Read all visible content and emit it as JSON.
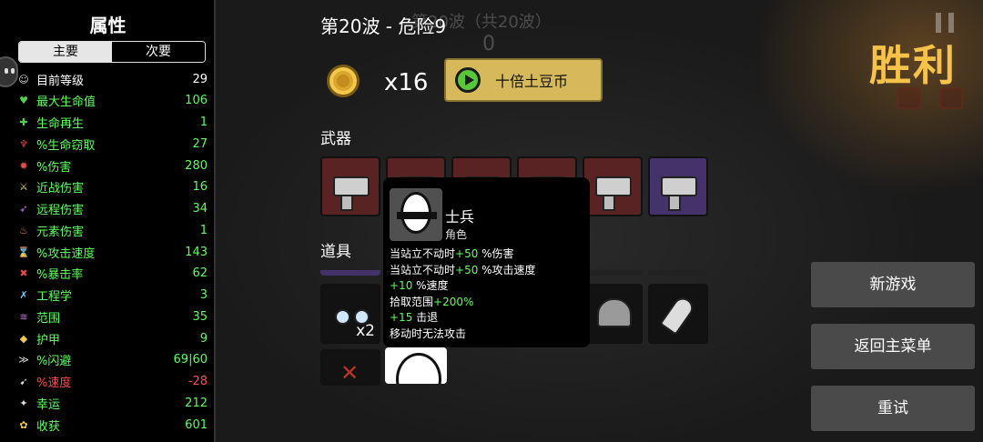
{
  "stats_panel": {
    "title": "属性",
    "tabs": {
      "primary": "主要",
      "secondary": "次要"
    },
    "rows": [
      {
        "icon": "level-icon",
        "name": "目前等级",
        "value": "29",
        "color": "white"
      },
      {
        "icon": "heart-icon",
        "name": "最大生命值",
        "value": "106",
        "color": "green"
      },
      {
        "icon": "regen-icon",
        "name": "生命再生",
        "value": "1",
        "color": "green"
      },
      {
        "icon": "lifesteal-icon",
        "name": "%生命窃取",
        "value": "27",
        "color": "green"
      },
      {
        "icon": "damage-icon",
        "name": "%伤害",
        "value": "280",
        "color": "green"
      },
      {
        "icon": "melee-icon",
        "name": "近战伤害",
        "value": "16",
        "color": "green"
      },
      {
        "icon": "ranged-icon",
        "name": "远程伤害",
        "value": "34",
        "color": "green"
      },
      {
        "icon": "elemental-icon",
        "name": "元素伤害",
        "value": "1",
        "color": "green"
      },
      {
        "icon": "attack-speed-icon",
        "name": "%攻击速度",
        "value": "143",
        "color": "green"
      },
      {
        "icon": "crit-icon",
        "name": "%暴击率",
        "value": "62",
        "color": "green"
      },
      {
        "icon": "engineering-icon",
        "name": "工程学",
        "value": "3",
        "color": "green"
      },
      {
        "icon": "range-icon",
        "name": "范围",
        "value": "35",
        "color": "green"
      },
      {
        "icon": "armor-icon",
        "name": "护甲",
        "value": "9",
        "color": "green"
      },
      {
        "icon": "dodge-icon",
        "name": "%闪避",
        "value": "69|60",
        "color": "green"
      },
      {
        "icon": "speed-icon",
        "name": "%速度",
        "value": "-28",
        "color": "red"
      },
      {
        "icon": "luck-icon",
        "name": "幸运",
        "value": "212",
        "color": "green"
      },
      {
        "icon": "harvest-icon",
        "name": "收获",
        "value": "601",
        "color": "green"
      }
    ]
  },
  "wave": {
    "title": "第20波 - 危险9",
    "ghost_line1": "第20波（共20波）",
    "ghost_line2": "0"
  },
  "coins": {
    "count": "x16",
    "button_label": "十倍土豆币"
  },
  "sections": {
    "weapons": "武器",
    "items": "道具"
  },
  "item_stack": "x2",
  "tooltip": {
    "name": "士兵",
    "type": "角色",
    "lines": [
      {
        "pre": "当站立不动时",
        "hi": "+50",
        "post": " %伤害"
      },
      {
        "pre": "当站立不动时",
        "hi": "+50",
        "post": " %攻击速度"
      },
      {
        "pre": "",
        "hi": "+10",
        "post": " %速度"
      },
      {
        "pre": "拾取范围",
        "hi": "+200%",
        "post": ""
      },
      {
        "pre": "",
        "hi": "+15",
        "post": " 击退"
      },
      {
        "pre": "移动时无法攻击",
        "hi": "",
        "post": ""
      }
    ]
  },
  "result": {
    "title": "胜利"
  },
  "menu": {
    "new_game": "新游戏",
    "main_menu": "返回主菜单",
    "retry": "重试"
  },
  "colors": {
    "positive": "#5cff5c",
    "negative": "#ff4a4a",
    "victory": "#f5c24a",
    "button": "#d6b95a"
  }
}
